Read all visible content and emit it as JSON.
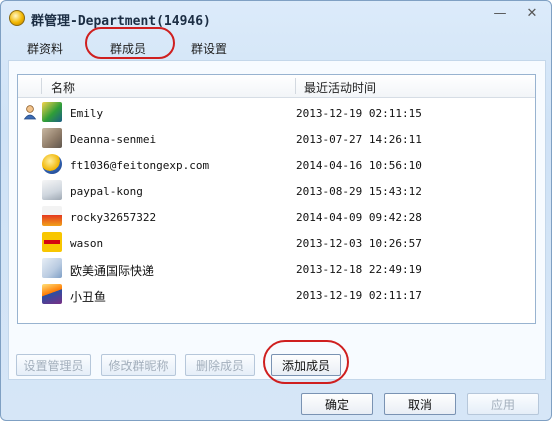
{
  "window": {
    "title": "群管理-Department(14946)",
    "minimize_icon": "minimize-icon",
    "close_icon": "close-icon"
  },
  "tabs": [
    {
      "label": "群资料",
      "active": false
    },
    {
      "label": "群成员",
      "active": true
    },
    {
      "label": "群设置",
      "active": false
    }
  ],
  "list": {
    "columns": [
      "名称",
      "最近活动时间"
    ],
    "rows": [
      {
        "name": "Emily",
        "time": "2013-12-19 02:11:15",
        "owner": true,
        "avatar": "emily-avatar"
      },
      {
        "name": "Deanna-senmei",
        "time": "2013-07-27 14:26:11",
        "owner": false,
        "avatar": "deanna-avatar"
      },
      {
        "name": "ft1036@feitongexp.com",
        "time": "2014-04-16 10:56:10",
        "owner": false,
        "avatar": "ft1036-avatar"
      },
      {
        "name": "paypal-kong",
        "time": "2013-08-29 15:43:12",
        "owner": false,
        "avatar": "paypal-avatar"
      },
      {
        "name": "rocky32657322",
        "time": "2014-04-09 09:42:28",
        "owner": false,
        "avatar": "rocky-avatar"
      },
      {
        "name": "wason",
        "time": "2013-12-03 10:26:57",
        "owner": false,
        "avatar": "wason-avatar"
      },
      {
        "name": "欧美通国际快递",
        "time": "2013-12-18 22:49:19",
        "owner": false,
        "avatar": "oumeitong-avatar"
      },
      {
        "name": "小丑鱼",
        "time": "2013-12-19 02:11:17",
        "owner": false,
        "avatar": "xiaochouyu-avatar"
      }
    ]
  },
  "actions": {
    "set_admin": "设置管理员",
    "edit_nickname": "修改群昵称",
    "delete_member": "删除成员",
    "add_member": "添加成员"
  },
  "dialog_buttons": {
    "ok": "确定",
    "cancel": "取消",
    "apply": "应用"
  }
}
